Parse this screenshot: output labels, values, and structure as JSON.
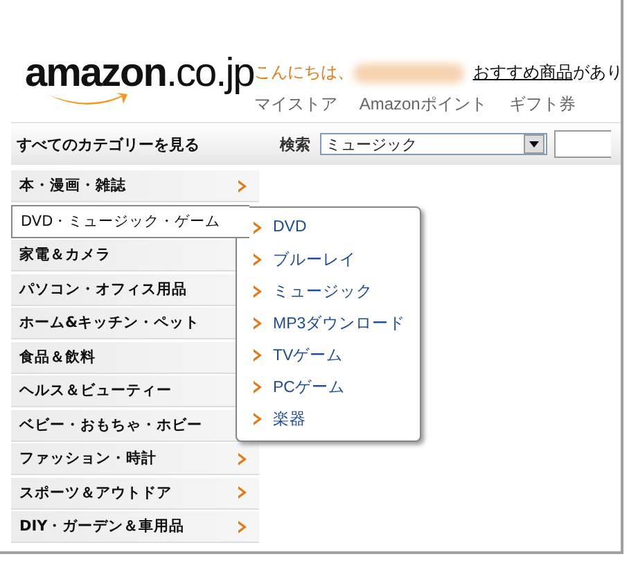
{
  "logo": {
    "name": "amazon",
    "suffix": ".co.jp"
  },
  "greeting": {
    "text": "こんにちは、",
    "link": "おすすめ商品",
    "after": "があり"
  },
  "nav_links": [
    "マイストア",
    "Amazonポイント",
    "ギフト券"
  ],
  "category_bar": {
    "all_categories": "すべてのカテゴリーを見る",
    "search_label": "検索",
    "dropdown_value": "ミュージック"
  },
  "categories": [
    {
      "label": "本・漫画・雑誌",
      "selected": false
    },
    {
      "label": "DVD・ミュージック・ゲーム",
      "selected": true
    },
    {
      "label": "家電＆カメラ",
      "selected": false
    },
    {
      "label": "パソコン・オフィス用品",
      "selected": false
    },
    {
      "label": "ホーム&キッチン・ペット",
      "selected": false
    },
    {
      "label": "食品＆飲料",
      "selected": false
    },
    {
      "label": "ヘルス＆ビューティー",
      "selected": false
    },
    {
      "label": "ベビー・おもちゃ・ホビー",
      "selected": false
    },
    {
      "label": "ファッション・時計",
      "selected": false
    },
    {
      "label": "スポーツ＆アウトドア",
      "selected": false
    },
    {
      "label": "DIY・ガーデン＆車用品",
      "selected": false
    }
  ],
  "flyout": [
    "DVD",
    "ブルーレイ",
    "ミュージック",
    "MP3ダウンロード",
    "TVゲーム",
    "PCゲーム",
    "楽器"
  ]
}
